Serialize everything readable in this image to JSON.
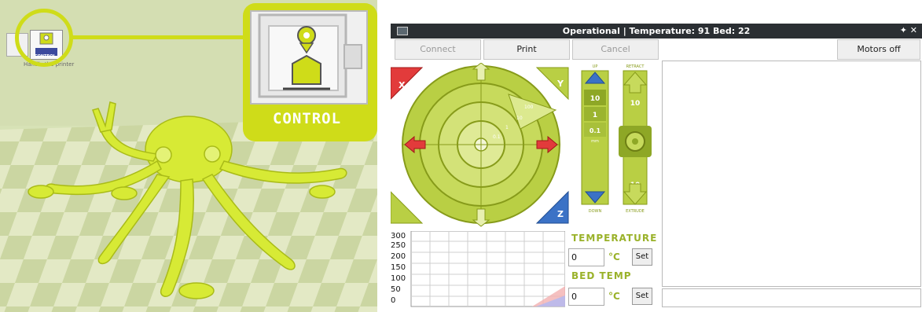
{
  "callout": {
    "label": "CONTROL"
  },
  "toolbar": {
    "caption_1": "cntrl",
    "caption_2": "CONTROL",
    "caption_3": "Handle the printer"
  },
  "window": {
    "title": "Operational | Temperature: 91 Bed: 22",
    "controls": "✦ ✕"
  },
  "buttons": {
    "connect": "Connect",
    "print": "Print",
    "cancel": "Cancel",
    "motors_off": "Motors off"
  },
  "jog": {
    "home_x": "X",
    "home_y": "Y",
    "home_z": "Z",
    "steps": [
      "100",
      "10",
      "1",
      "0.1"
    ],
    "axis_y_plus": "Y",
    "axis_y_minus": "Y",
    "axis_x_minus": "X",
    "axis_x_plus": "X"
  },
  "zaxis": {
    "up_label": "UP",
    "down_label": "DOWN",
    "values": [
      "10",
      "1",
      "0.1",
      "mm"
    ]
  },
  "extruder": {
    "retract_label": "RETRACT",
    "extrude_label": "EXTRUDE",
    "amount_top": "10",
    "amount_bottom": "10"
  },
  "temperature": {
    "title": "TEMPERATURE",
    "value": "0",
    "unit": "°C",
    "set_label": "Set"
  },
  "bed": {
    "title": "BED TEMP",
    "value": "0",
    "unit": "°C",
    "set_label": "Set"
  },
  "graph": {
    "ticks": [
      "300",
      "250",
      "200",
      "150",
      "100",
      "50",
      "0"
    ]
  },
  "colors": {
    "accent": "#cfdc19",
    "model": "#d8ec3a",
    "floor_light": "#e6ecc8",
    "floor_dark": "#c9d59f",
    "title_bar": "#2b2f33"
  }
}
